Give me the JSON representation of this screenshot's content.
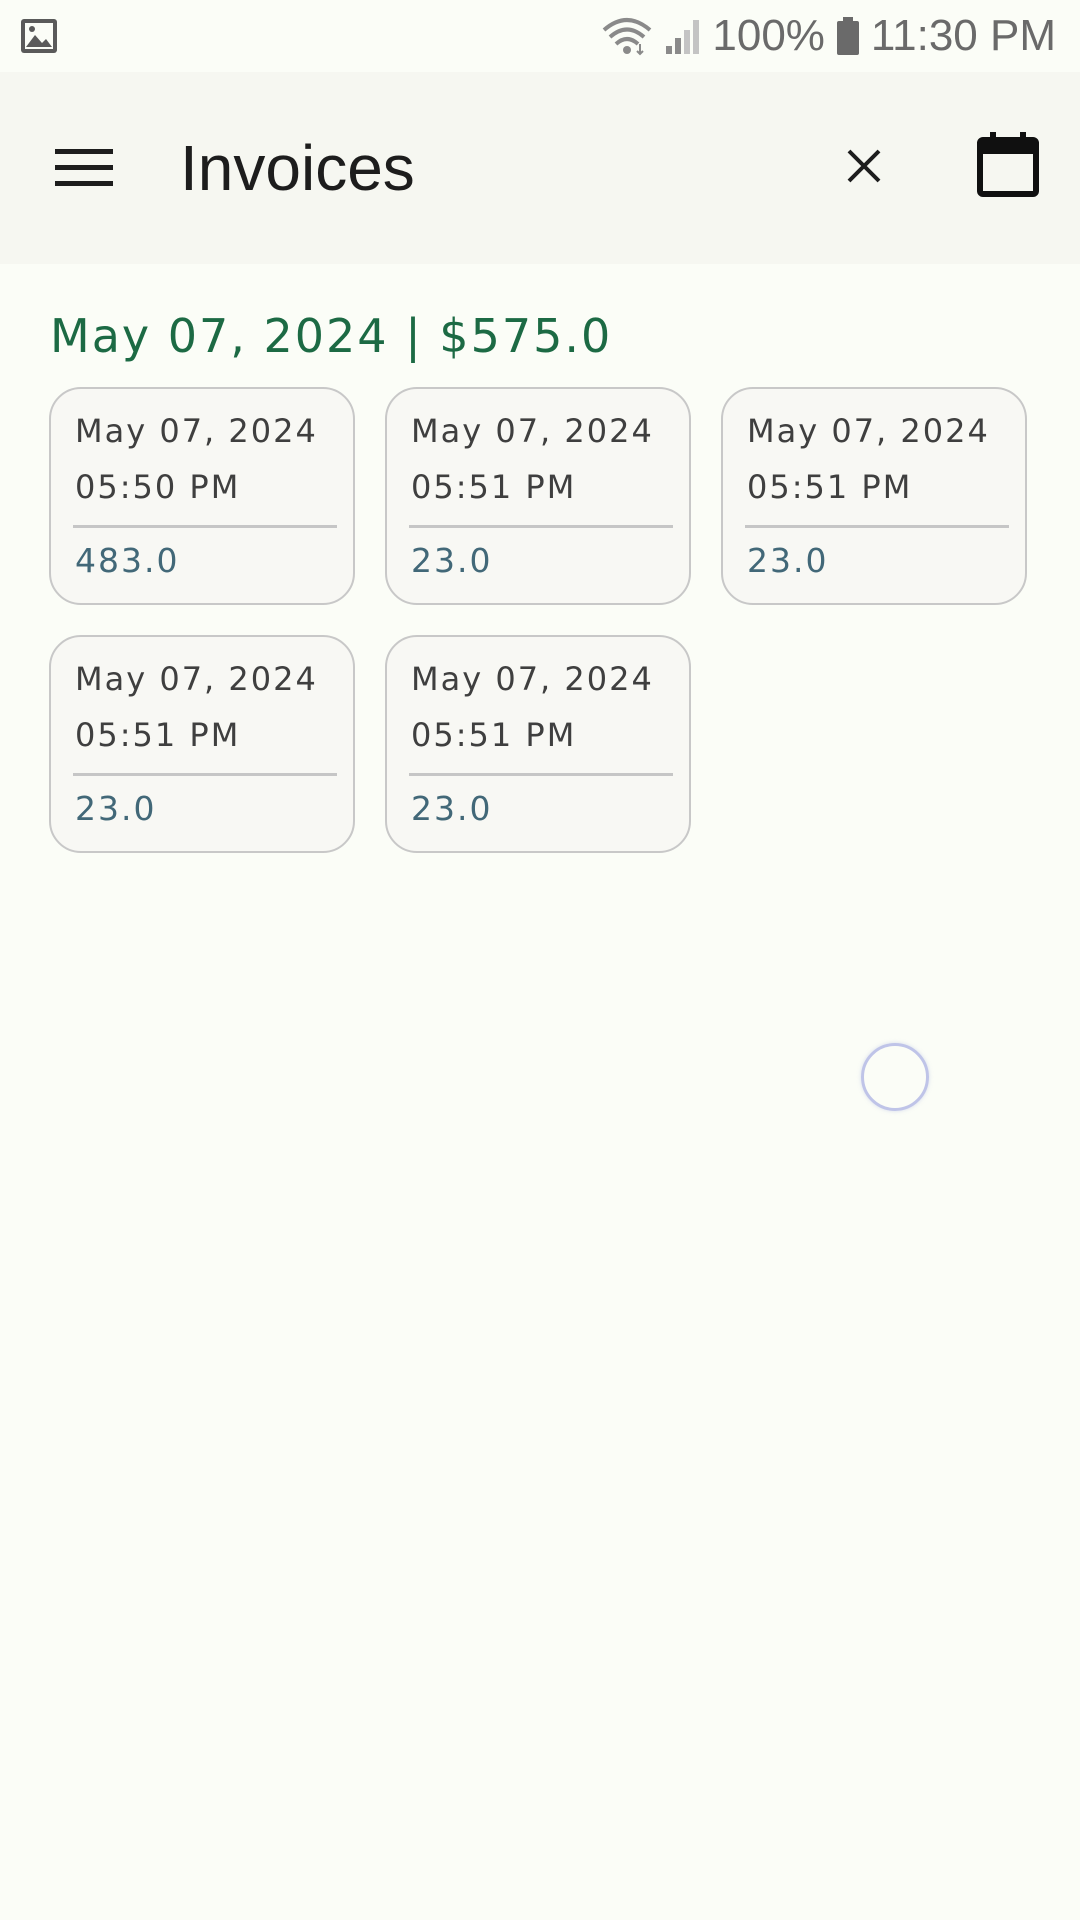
{
  "status_bar": {
    "left_icon": "image-notification-icon",
    "wifi_icon": "wifi-icon",
    "signal_icon": "signal-icon",
    "battery_icon": "battery-icon",
    "battery_text": "100%",
    "time": "11:30 PM"
  },
  "app_bar": {
    "title": "Invoices",
    "menu_icon": "menu-icon",
    "close_icon": "close-icon",
    "calendar_icon": "calendar-icon"
  },
  "colors": {
    "header_green": "#1c6a44",
    "amount_blue": "#426878",
    "card_border": "#c8c8c8",
    "background": "#fbfdf7",
    "app_bar": "#f6f7f1"
  },
  "group": {
    "header": "May 07, 2024 | $575.0"
  },
  "invoices": [
    {
      "date": "May 07, 2024",
      "time": "05:50 PM",
      "amount": "483.0"
    },
    {
      "date": "May 07, 2024",
      "time": "05:51 PM",
      "amount": "23.0"
    },
    {
      "date": "May 07, 2024",
      "time": "05:51 PM",
      "amount": "23.0"
    },
    {
      "date": "May 07, 2024",
      "time": "05:51 PM",
      "amount": "23.0"
    },
    {
      "date": "May 07, 2024",
      "time": "05:51 PM",
      "amount": "23.0"
    }
  ]
}
